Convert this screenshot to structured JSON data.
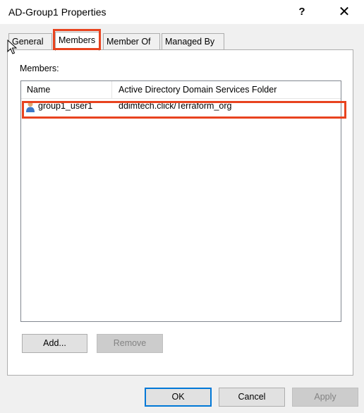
{
  "window": {
    "title": "AD-Group1 Properties",
    "help_label": "?",
    "close_label": "✕"
  },
  "tabs": [
    {
      "label": "General"
    },
    {
      "label": "Members"
    },
    {
      "label": "Member Of"
    },
    {
      "label": "Managed By"
    }
  ],
  "active_tab": "Members",
  "members": {
    "label": "Members:",
    "columns": [
      "Name",
      "Active Directory Domain Services Folder"
    ],
    "rows": [
      {
        "name": "group1_user1",
        "folder": "ddimtech.click/Terraform_org",
        "icon": "user-icon"
      }
    ],
    "add_label": "Add...",
    "remove_label": "Remove"
  },
  "footer": {
    "ok_label": "OK",
    "cancel_label": "Cancel",
    "apply_label": "Apply"
  },
  "colors": {
    "highlight": "#e8431f",
    "default_button_border": "#0078d7"
  }
}
